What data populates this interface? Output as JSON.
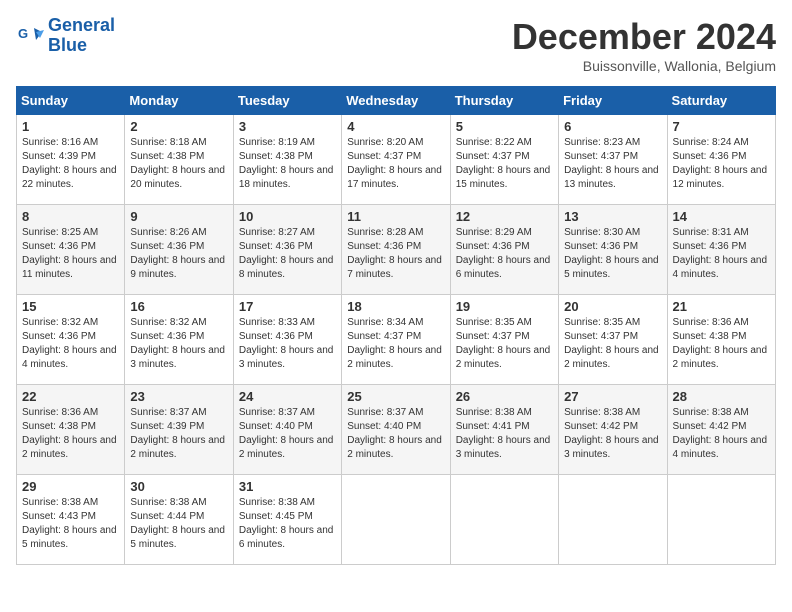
{
  "logo": {
    "line1": "General",
    "line2": "Blue"
  },
  "title": "December 2024",
  "subtitle": "Buissonville, Wallonia, Belgium",
  "weekdays": [
    "Sunday",
    "Monday",
    "Tuesday",
    "Wednesday",
    "Thursday",
    "Friday",
    "Saturday"
  ],
  "weeks": [
    [
      {
        "day": "1",
        "sunrise": "8:16 AM",
        "sunset": "4:39 PM",
        "daylight": "8 hours and 22 minutes."
      },
      {
        "day": "2",
        "sunrise": "8:18 AM",
        "sunset": "4:38 PM",
        "daylight": "8 hours and 20 minutes."
      },
      {
        "day": "3",
        "sunrise": "8:19 AM",
        "sunset": "4:38 PM",
        "daylight": "8 hours and 18 minutes."
      },
      {
        "day": "4",
        "sunrise": "8:20 AM",
        "sunset": "4:37 PM",
        "daylight": "8 hours and 17 minutes."
      },
      {
        "day": "5",
        "sunrise": "8:22 AM",
        "sunset": "4:37 PM",
        "daylight": "8 hours and 15 minutes."
      },
      {
        "day": "6",
        "sunrise": "8:23 AM",
        "sunset": "4:37 PM",
        "daylight": "8 hours and 13 minutes."
      },
      {
        "day": "7",
        "sunrise": "8:24 AM",
        "sunset": "4:36 PM",
        "daylight": "8 hours and 12 minutes."
      }
    ],
    [
      {
        "day": "8",
        "sunrise": "8:25 AM",
        "sunset": "4:36 PM",
        "daylight": "8 hours and 11 minutes."
      },
      {
        "day": "9",
        "sunrise": "8:26 AM",
        "sunset": "4:36 PM",
        "daylight": "8 hours and 9 minutes."
      },
      {
        "day": "10",
        "sunrise": "8:27 AM",
        "sunset": "4:36 PM",
        "daylight": "8 hours and 8 minutes."
      },
      {
        "day": "11",
        "sunrise": "8:28 AM",
        "sunset": "4:36 PM",
        "daylight": "8 hours and 7 minutes."
      },
      {
        "day": "12",
        "sunrise": "8:29 AM",
        "sunset": "4:36 PM",
        "daylight": "8 hours and 6 minutes."
      },
      {
        "day": "13",
        "sunrise": "8:30 AM",
        "sunset": "4:36 PM",
        "daylight": "8 hours and 5 minutes."
      },
      {
        "day": "14",
        "sunrise": "8:31 AM",
        "sunset": "4:36 PM",
        "daylight": "8 hours and 4 minutes."
      }
    ],
    [
      {
        "day": "15",
        "sunrise": "8:32 AM",
        "sunset": "4:36 PM",
        "daylight": "8 hours and 4 minutes."
      },
      {
        "day": "16",
        "sunrise": "8:32 AM",
        "sunset": "4:36 PM",
        "daylight": "8 hours and 3 minutes."
      },
      {
        "day": "17",
        "sunrise": "8:33 AM",
        "sunset": "4:36 PM",
        "daylight": "8 hours and 3 minutes."
      },
      {
        "day": "18",
        "sunrise": "8:34 AM",
        "sunset": "4:37 PM",
        "daylight": "8 hours and 2 minutes."
      },
      {
        "day": "19",
        "sunrise": "8:35 AM",
        "sunset": "4:37 PM",
        "daylight": "8 hours and 2 minutes."
      },
      {
        "day": "20",
        "sunrise": "8:35 AM",
        "sunset": "4:37 PM",
        "daylight": "8 hours and 2 minutes."
      },
      {
        "day": "21",
        "sunrise": "8:36 AM",
        "sunset": "4:38 PM",
        "daylight": "8 hours and 2 minutes."
      }
    ],
    [
      {
        "day": "22",
        "sunrise": "8:36 AM",
        "sunset": "4:38 PM",
        "daylight": "8 hours and 2 minutes."
      },
      {
        "day": "23",
        "sunrise": "8:37 AM",
        "sunset": "4:39 PM",
        "daylight": "8 hours and 2 minutes."
      },
      {
        "day": "24",
        "sunrise": "8:37 AM",
        "sunset": "4:40 PM",
        "daylight": "8 hours and 2 minutes."
      },
      {
        "day": "25",
        "sunrise": "8:37 AM",
        "sunset": "4:40 PM",
        "daylight": "8 hours and 2 minutes."
      },
      {
        "day": "26",
        "sunrise": "8:38 AM",
        "sunset": "4:41 PM",
        "daylight": "8 hours and 3 minutes."
      },
      {
        "day": "27",
        "sunrise": "8:38 AM",
        "sunset": "4:42 PM",
        "daylight": "8 hours and 3 minutes."
      },
      {
        "day": "28",
        "sunrise": "8:38 AM",
        "sunset": "4:42 PM",
        "daylight": "8 hours and 4 minutes."
      }
    ],
    [
      {
        "day": "29",
        "sunrise": "8:38 AM",
        "sunset": "4:43 PM",
        "daylight": "8 hours and 5 minutes."
      },
      {
        "day": "30",
        "sunrise": "8:38 AM",
        "sunset": "4:44 PM",
        "daylight": "8 hours and 5 minutes."
      },
      {
        "day": "31",
        "sunrise": "8:38 AM",
        "sunset": "4:45 PM",
        "daylight": "8 hours and 6 minutes."
      },
      null,
      null,
      null,
      null
    ]
  ]
}
